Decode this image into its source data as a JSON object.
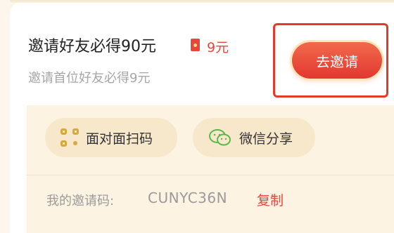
{
  "invite": {
    "title": "邀请好友必得90元",
    "reward": "9元",
    "subtitle": "邀请首位好友必得9元",
    "button": "去邀请"
  },
  "share": {
    "qr_label": "面对面扫码",
    "wechat_label": "微信分享"
  },
  "code": {
    "label": "我的邀请码:",
    "value": "CUNYC36N",
    "copy": "复制"
  },
  "colors": {
    "accent": "#e8453d",
    "panel": "#fcf3e3",
    "chip": "#f8e8cb",
    "highlight": "#e03b2b"
  }
}
